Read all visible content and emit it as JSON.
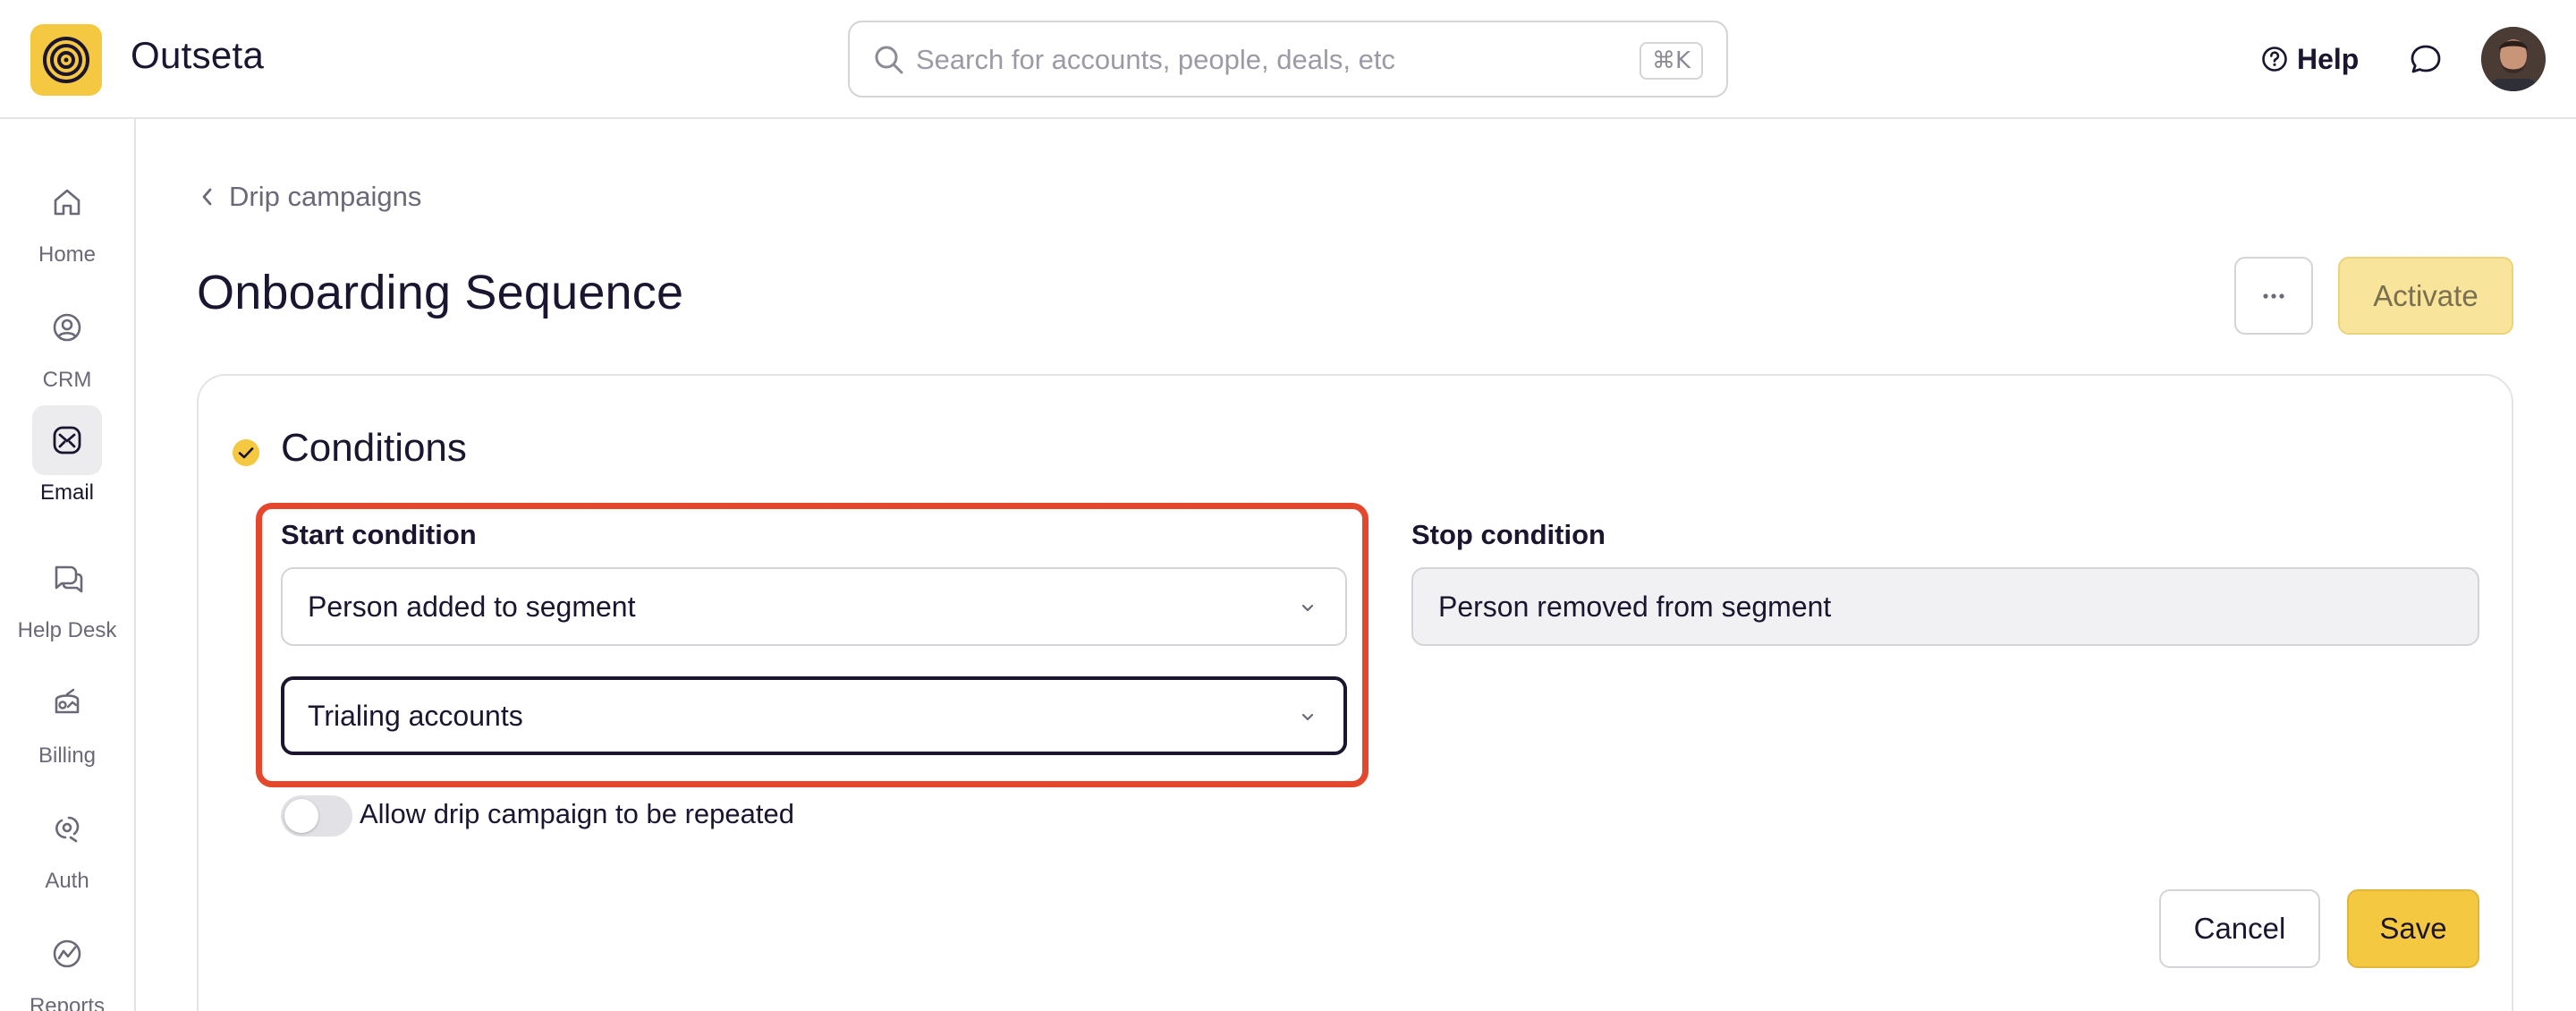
{
  "app": {
    "brand": "Outseta",
    "logo_color": "#f5c842"
  },
  "search": {
    "placeholder": "Search for accounts, people, deals, etc",
    "value": "",
    "shortcut": "⌘K",
    "icon": "search-icon"
  },
  "header": {
    "help_label": "Help",
    "help_icon": "help-circle-icon",
    "chat_icon": "chat-bubble-icon",
    "avatar_icon": "user-avatar"
  },
  "sidebar": {
    "items": [
      {
        "label": "Home",
        "icon": "home-icon",
        "active": false
      },
      {
        "label": "CRM",
        "icon": "crm-icon",
        "active": false
      },
      {
        "label": "Email",
        "icon": "email-icon",
        "active": true
      },
      {
        "label": "Help Desk",
        "icon": "help-desk-icon",
        "active": false
      },
      {
        "label": "Billing",
        "icon": "billing-icon",
        "active": false
      },
      {
        "label": "Auth",
        "icon": "auth-icon",
        "active": false
      },
      {
        "label": "Reports",
        "icon": "reports-icon",
        "active": false
      }
    ]
  },
  "breadcrumb": {
    "back_label": "Drip campaigns",
    "icon": "chevron-left-icon"
  },
  "page": {
    "title": "Onboarding Sequence",
    "more_icon": "ellipsis-icon",
    "activate_label": "Activate"
  },
  "conditions": {
    "title": "Conditions",
    "status_icon": "check-circle-icon",
    "start_label": "Start condition",
    "start_trigger": "Person added to segment",
    "start_segment": "Trialing accounts",
    "stop_label": "Stop condition",
    "stop_value": "Person removed from segment",
    "repeat_label": "Allow drip campaign to be repeated",
    "repeat_enabled": false,
    "cancel_label": "Cancel",
    "save_label": "Save"
  },
  "colors": {
    "accent": "#f5c842",
    "highlight": "#e5472c",
    "text": "#1b1530"
  }
}
